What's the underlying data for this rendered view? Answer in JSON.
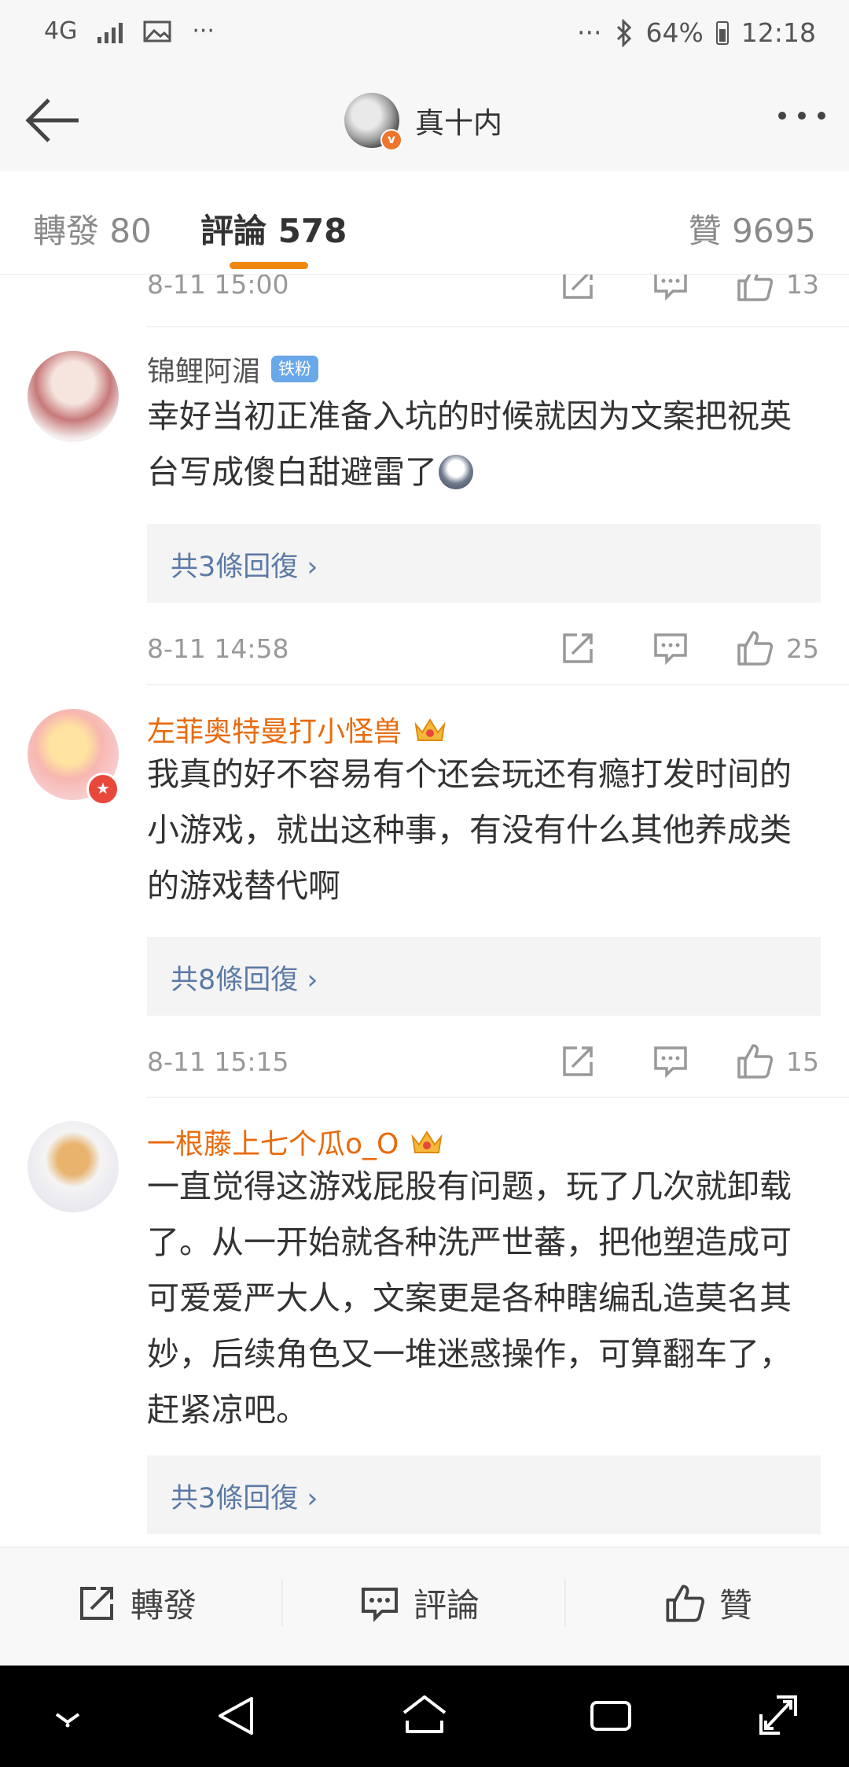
{
  "status_bar": {
    "network": "4G",
    "dots": "···",
    "battery": "64%",
    "time": "12:18"
  },
  "nav": {
    "title": "真十内"
  },
  "tabs": [
    {
      "label": "轉發 80"
    },
    {
      "label": "評論 578"
    },
    {
      "label": "贊 9695"
    }
  ],
  "top_row": {
    "date": "8-11 15:00",
    "likes": "13"
  },
  "comments": [
    {
      "username": "锦鲤阿湄",
      "badge": "铁粉",
      "text": "幸好当初正准备入坑的时候就因为文案把祝英台写成傻白甜避雷了",
      "replies": "共3條回復 ›",
      "date": "8-11 14:58",
      "likes": "25"
    },
    {
      "username": "左菲奥特曼打小怪兽",
      "text": "我真的好不容易有个还会玩还有瘾打发时间的小游戏，就出这种事，有没有什么其他养成类的游戏替代啊",
      "replies": "共8條回復 ›",
      "date": "8-11 15:15",
      "likes": "15"
    },
    {
      "username": "一根藤上七个瓜o_O",
      "text": "一直觉得这游戏屁股有问题，玩了几次就卸载了。从一开始就各种洗严世蕃，把他塑造成可可爱爱严大人，文案更是各种瞎编乱造莫名其妙，后续角色又一堆迷惑操作，可算翻车了，赶紧凉吧。",
      "replies": "共3條回復 ›"
    }
  ],
  "bottom_bar": {
    "repost": "轉發",
    "comment": "評論",
    "like": "贊"
  }
}
